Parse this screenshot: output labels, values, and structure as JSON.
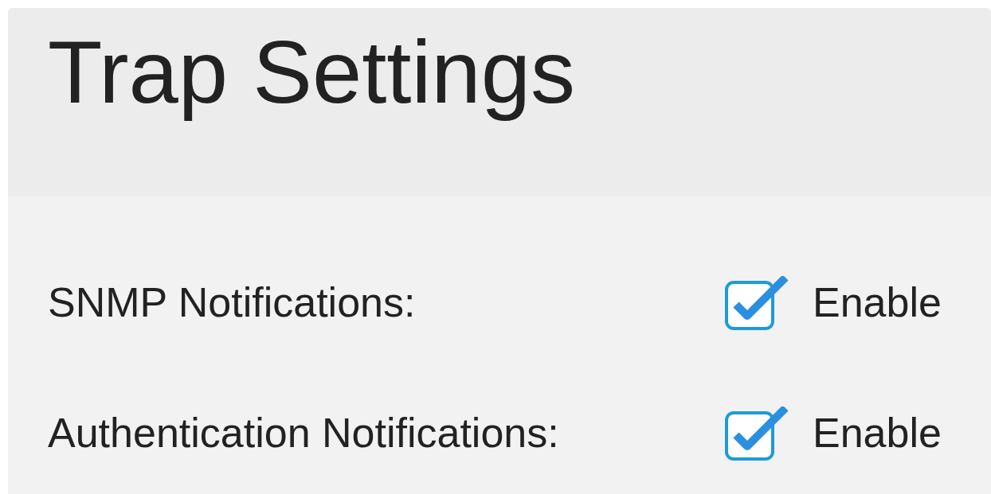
{
  "title": "Trap Settings",
  "rows": [
    {
      "label": "SNMP Notifications:",
      "option": "Enable",
      "checked": true
    },
    {
      "label": "Authentication Notifications:",
      "option": "Enable",
      "checked": true
    }
  ]
}
